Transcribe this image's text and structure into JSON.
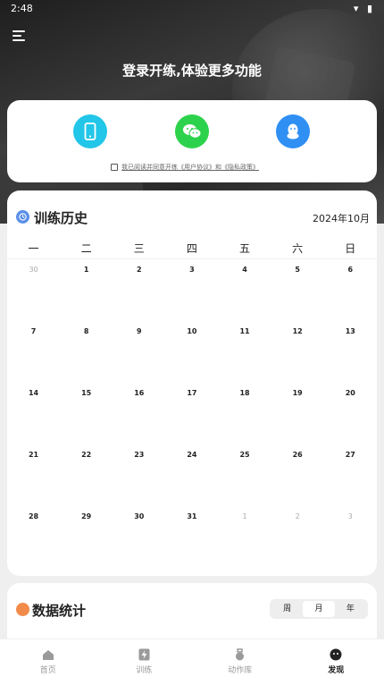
{
  "status": {
    "time": "2:48",
    "icons": "▾ ▮"
  },
  "header": {
    "title": "登录开练,体验更多功能"
  },
  "login": {
    "options": [
      {
        "name": "phone-login-icon"
      },
      {
        "name": "wechat-login-icon"
      },
      {
        "name": "qq-login-icon"
      }
    ],
    "agreement": "我已阅读并同意开练《用户协议》和《隐私政策》"
  },
  "history": {
    "title": "训练历史",
    "month": "2024年10月",
    "weekdays": [
      "一",
      "二",
      "三",
      "四",
      "五",
      "六",
      "日"
    ],
    "weeks": [
      [
        {
          "d": "30",
          "o": true
        },
        {
          "d": "1"
        },
        {
          "d": "2"
        },
        {
          "d": "3"
        },
        {
          "d": "4"
        },
        {
          "d": "5"
        },
        {
          "d": "6"
        }
      ],
      [
        {
          "d": "7"
        },
        {
          "d": "8"
        },
        {
          "d": "9"
        },
        {
          "d": "10"
        },
        {
          "d": "11"
        },
        {
          "d": "12"
        },
        {
          "d": "13"
        }
      ],
      [
        {
          "d": "14"
        },
        {
          "d": "15"
        },
        {
          "d": "16"
        },
        {
          "d": "17"
        },
        {
          "d": "18"
        },
        {
          "d": "19"
        },
        {
          "d": "20"
        }
      ],
      [
        {
          "d": "21"
        },
        {
          "d": "22"
        },
        {
          "d": "23"
        },
        {
          "d": "24"
        },
        {
          "d": "25"
        },
        {
          "d": "26"
        },
        {
          "d": "27"
        }
      ],
      [
        {
          "d": "28"
        },
        {
          "d": "29"
        },
        {
          "d": "30"
        },
        {
          "d": "31"
        },
        {
          "d": "1",
          "o": true
        },
        {
          "d": "2",
          "o": true
        },
        {
          "d": "3",
          "o": true
        }
      ]
    ]
  },
  "stats": {
    "title": "数据统计",
    "segments": [
      "周",
      "月",
      "年"
    ],
    "active_segment": "月"
  },
  "tabs": {
    "home": "首页",
    "train": "训练",
    "library": "动作库",
    "discover": "发现"
  },
  "colors": {
    "phone": "#22c6e8",
    "wechat": "#2dd24c",
    "qq": "#2f8ff3",
    "history_icon": "#5b8fe8",
    "stats_icon": "#f28b4a"
  }
}
